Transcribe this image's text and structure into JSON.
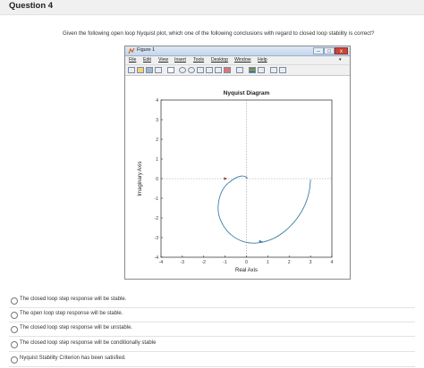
{
  "question": {
    "title": "Question 4",
    "text": "Given the following open loop Nyquist plot, which one of the following conclusions with regard to closed loop stability is correct?"
  },
  "figure_window": {
    "title": "Figure 1",
    "controls": {
      "minimize": "–",
      "maximize": "□",
      "close": "x"
    },
    "menu": [
      "File",
      "Edit",
      "View",
      "Insert",
      "Tools",
      "Desktop",
      "Window",
      "Help"
    ],
    "menu_arrow": "▾",
    "toolbar_icons": [
      "new-icon",
      "open-icon",
      "save-icon",
      "print-icon",
      "pointer-icon",
      "zoom-in-icon",
      "zoom-out-icon",
      "pan-icon",
      "rotate-icon",
      "data-cursor-icon",
      "brush-icon",
      "link-icon",
      "colorbar-icon",
      "legend-icon",
      "hide-plot-tools-icon",
      "show-plot-tools-icon"
    ]
  },
  "chart_data": {
    "type": "line",
    "title": "Nyquist Diagram",
    "xlabel": "Real Axis",
    "ylabel": "Imaginary Axis",
    "xlim": [
      -4,
      4
    ],
    "ylim": [
      -4,
      4
    ],
    "xticks": [
      "-4",
      "-3",
      "-2",
      "-1",
      "0",
      "1",
      "2",
      "3",
      "4"
    ],
    "yticks": [
      "4",
      "3",
      "2",
      "1",
      "0",
      "-1",
      "-2",
      "-3",
      "-4"
    ],
    "grid": false,
    "axis_lines": {
      "real_axis_dotted": true,
      "imag_axis_dotted": true
    },
    "critical_point": [
      -1,
      0
    ],
    "series": [
      {
        "color": "#3d7ea6",
        "points": [
          [
            3.0,
            -0.05
          ],
          [
            2.95,
            -0.7
          ],
          [
            2.7,
            -1.5
          ],
          [
            2.2,
            -2.3
          ],
          [
            1.5,
            -2.95
          ],
          [
            0.8,
            -3.25
          ],
          [
            0.15,
            -3.3
          ],
          [
            -0.45,
            -3.1
          ],
          [
            -1.0,
            -2.6
          ],
          [
            -1.35,
            -1.8
          ],
          [
            -1.3,
            -1.0
          ],
          [
            -1.05,
            -0.4
          ],
          [
            -0.65,
            -0.05
          ],
          [
            -0.4,
            0.1
          ],
          [
            -0.15,
            0.15
          ],
          [
            0.05,
            0.05
          ],
          [
            0.0,
            0.0
          ]
        ]
      }
    ],
    "arrows": [
      [
        0.7,
        -3.2
      ],
      [
        -0.95,
        0.0
      ]
    ]
  },
  "options": [
    "The closed loop step response will be stable.",
    "The open loop step response will be stable.",
    "The closed loop step response will be unstable.",
    "The closed loop step response will be conditionally stable",
    "Nyquist Stability Criterion has been satisfied."
  ]
}
